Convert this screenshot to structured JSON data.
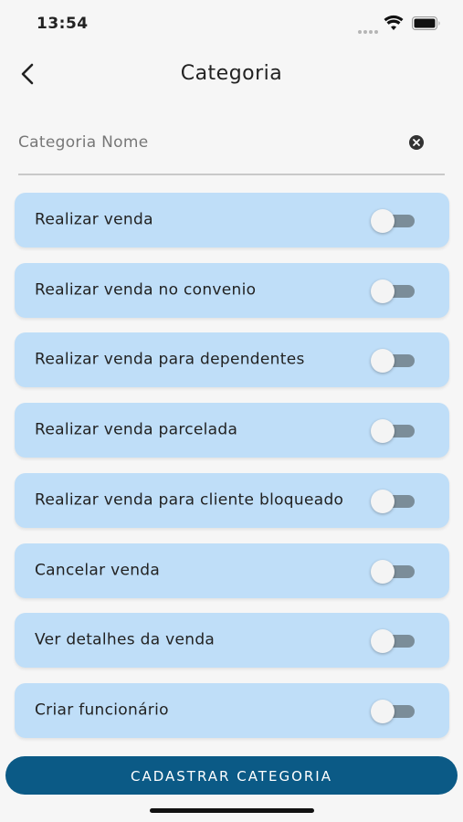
{
  "status_bar": {
    "time": "13:54"
  },
  "header": {
    "title": "Categoria"
  },
  "form": {
    "name_placeholder": "Categoria Nome",
    "name_value": ""
  },
  "permissions": [
    {
      "label": "Realizar venda",
      "enabled": false
    },
    {
      "label": "Realizar venda no convenio",
      "enabled": false
    },
    {
      "label": "Realizar venda para dependentes",
      "enabled": false
    },
    {
      "label": "Realizar venda parcelada",
      "enabled": false
    },
    {
      "label": "Realizar venda para cliente bloqueado",
      "enabled": false
    },
    {
      "label": "Cancelar venda",
      "enabled": false
    },
    {
      "label": "Ver detalhes da venda",
      "enabled": false
    },
    {
      "label": "Criar funcionário",
      "enabled": false
    }
  ],
  "actions": {
    "submit_label": "CADASTRAR CATEGORIA"
  },
  "colors": {
    "card_bg": "#bfdef8",
    "primary": "#0b5a86",
    "toggle_track": "#7b8d99"
  }
}
